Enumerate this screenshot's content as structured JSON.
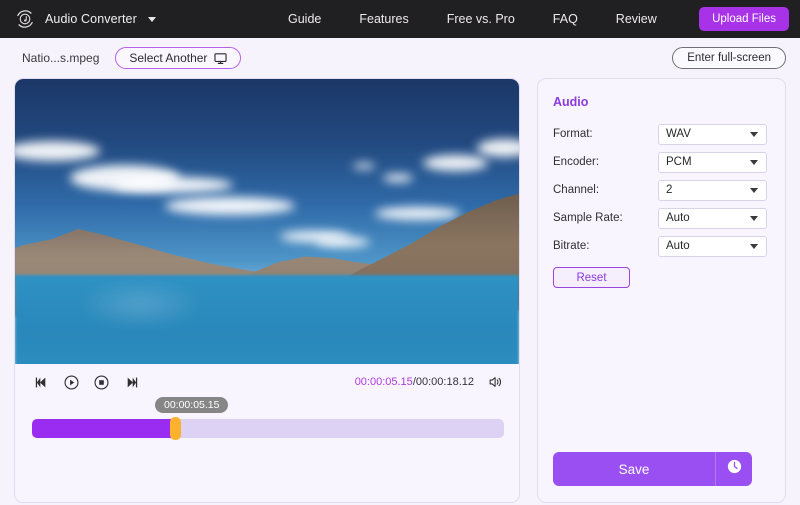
{
  "topbar": {
    "logo_icon": "audio-convert-circle-icon",
    "brand": "Audio Converter",
    "caret_icon": "chevron-down-icon",
    "nav": [
      {
        "label": "Guide"
      },
      {
        "label": "Features"
      },
      {
        "label": "Free vs. Pro"
      },
      {
        "label": "FAQ"
      },
      {
        "label": "Review"
      }
    ],
    "upload_label": "Upload Files",
    "accent": "#a832e8",
    "background": "#201f22"
  },
  "filebar": {
    "filename": "Natio...s.mpeg",
    "select_another_label": "Select Another",
    "monitor_icon": "monitor-icon",
    "fullscreen_label": "Enter full-screen"
  },
  "player": {
    "controls": [
      {
        "name": "previous",
        "icon": "previous-track-icon"
      },
      {
        "name": "play",
        "icon": "play-circle-icon"
      },
      {
        "name": "stop",
        "icon": "stop-circle-icon"
      },
      {
        "name": "next",
        "icon": "next-track-icon"
      }
    ],
    "current_time": "00:00:05.15",
    "time_separator": "/",
    "total_time": "00:00:18.12",
    "volume_icon": "volume-speaker-icon",
    "tooltip_time": "00:00:05.15",
    "progress_percent": 30,
    "progress_fill_color": "#9a2bf0",
    "progress_track_color": "#ded2f4",
    "handle_color": "#fcb22c",
    "current_time_color": "#b23ae0"
  },
  "settings": {
    "title": "Audio",
    "title_color": "#8a3ae0",
    "rows": [
      {
        "label": "Format:",
        "value": "WAV"
      },
      {
        "label": "Encoder:",
        "value": "PCM"
      },
      {
        "label": "Channel:",
        "value": "2"
      },
      {
        "label": "Sample Rate:",
        "value": "Auto"
      },
      {
        "label": "Bitrate:",
        "value": "Auto"
      }
    ],
    "reset_label": "Reset",
    "save_label": "Save",
    "history_icon": "clock-icon",
    "save_color": "#9a4ff2"
  }
}
